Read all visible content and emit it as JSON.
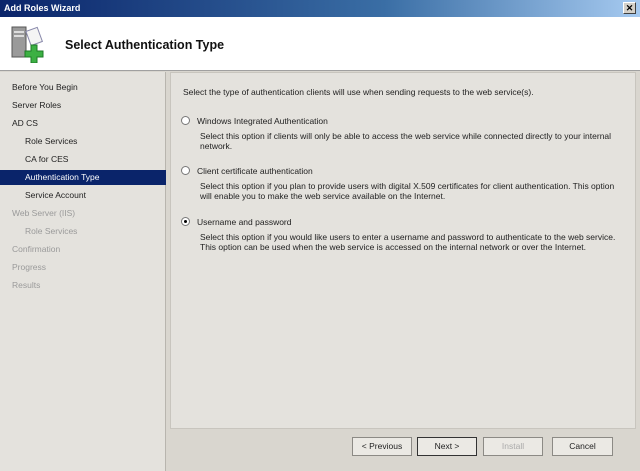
{
  "window": {
    "title": "Add Roles Wizard",
    "close_label": "✕"
  },
  "header": {
    "title": "Select Authentication Type"
  },
  "nav": [
    {
      "label": "Before You Begin",
      "level": 0,
      "state": "normal"
    },
    {
      "label": "Server Roles",
      "level": 0,
      "state": "normal"
    },
    {
      "label": "AD CS",
      "level": 0,
      "state": "normal"
    },
    {
      "label": "Role Services",
      "level": 1,
      "state": "normal"
    },
    {
      "label": "CA for CES",
      "level": 1,
      "state": "normal"
    },
    {
      "label": "Authentication Type",
      "level": 1,
      "state": "selected"
    },
    {
      "label": "Service Account",
      "level": 1,
      "state": "normal"
    },
    {
      "label": "Web Server (IIS)",
      "level": 0,
      "state": "disabled"
    },
    {
      "label": "Role Services",
      "level": 1,
      "state": "disabled"
    },
    {
      "label": "Confirmation",
      "level": 0,
      "state": "disabled"
    },
    {
      "label": "Progress",
      "level": 0,
      "state": "disabled"
    },
    {
      "label": "Results",
      "level": 0,
      "state": "disabled"
    }
  ],
  "main": {
    "intro": "Select the type of authentication clients will use when sending requests to the web service(s).",
    "options": [
      {
        "label": "Windows Integrated Authentication",
        "selected": false,
        "description": "Select this option if clients will only be able to access the web service while connected directly to your internal network."
      },
      {
        "label": "Client certificate authentication",
        "selected": false,
        "description": "Select this option if you plan to provide users with digital X.509 certificates for client authentication.  This option will enable you to make the web service available on the Internet."
      },
      {
        "label": "Username and password",
        "selected": true,
        "description": "Select this option if you would like users to enter a username and password to authenticate to the web service. This option can be used when the web service is accessed on the internal network or over the Internet."
      }
    ]
  },
  "buttons": {
    "previous": "< Previous",
    "next": "Next >",
    "install": "Install",
    "cancel": "Cancel"
  }
}
